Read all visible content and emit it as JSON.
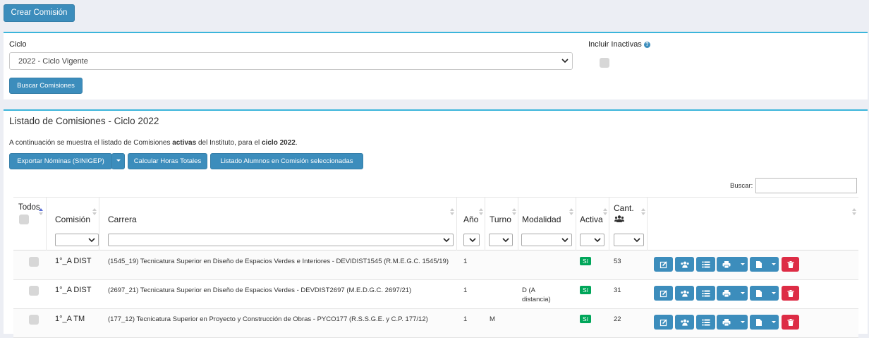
{
  "toolbar": {
    "create_label": "Crear Comisión"
  },
  "filters": {
    "ciclo_label": "Ciclo",
    "ciclo_value": "2022 - Ciclo Vigente",
    "incluir_label": "Incluir Inactivas",
    "help_glyph": "?",
    "search_label": "Buscar Comisiones"
  },
  "list": {
    "title": "Listado de Comisiones - Ciclo 2022",
    "desc_prefix": "A continuación se muestra el listado de Comisiones ",
    "desc_bold1": "activas",
    "desc_mid": " del Instituto, para el ",
    "desc_bold2": "ciclo 2022",
    "desc_suffix": ".",
    "export_label": "Exportar Nóminas (SINIGEP)",
    "hours_label": "Calcular Horas Totales",
    "students_label": "Listado Alumnos en Comisión seleccionadas",
    "search_label": "Buscar:"
  },
  "table": {
    "headers": {
      "todos": "Todos",
      "comision": "Comisión",
      "carrera": "Carrera",
      "anio": "Año",
      "turno": "Turno",
      "modalidad": "Modalidad",
      "activa": "Activa",
      "cant": "Cant."
    },
    "rows": [
      {
        "comision": "1°_A DIST",
        "carrera": "(1545_19) Tecnicatura Superior en Diseño de Espacios Verdes e Interiores - DEVIDIST1545 (R.M.E.G.C. 1545/19)",
        "anio": "1",
        "turno": "",
        "modalidad": "",
        "activa": "Sí",
        "cant": "53"
      },
      {
        "comision": "1°_A DIST",
        "carrera": "(2697_21) Tecnicatura Superior en Diseño de Espacios Verdes - DEVDIST2697 (M.E.D.G.C. 2697/21)",
        "anio": "1",
        "turno": "",
        "modalidad": "D (A distancia)",
        "activa": "Sí",
        "cant": "31"
      },
      {
        "comision": "1°_A TM",
        "carrera": "(177_12) Tecnicatura Superior en Proyecto y Construcción de Obras - PYCO177 (R.S.S.G.E. y C.P. 177/12)",
        "anio": "1",
        "turno": "M",
        "modalidad": "",
        "activa": "Sí",
        "cant": "22"
      }
    ]
  },
  "colors": {
    "primary": "#3c8dbc",
    "accent_border": "#3bb5db",
    "success": "#00a65a",
    "danger": "#dd2c45"
  }
}
